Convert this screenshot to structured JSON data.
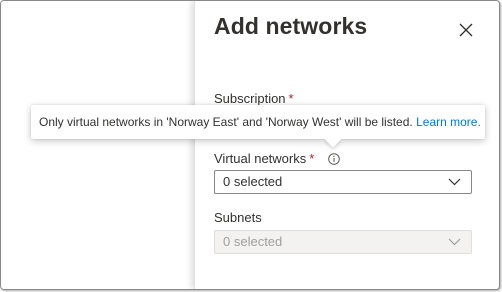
{
  "panel": {
    "title": "Add networks",
    "close_label": "Close"
  },
  "fields": {
    "subscription": {
      "label": "Subscription",
      "required_marker": "*"
    },
    "virtual_networks": {
      "label": "Virtual networks",
      "required_marker": "*",
      "value": "0 selected",
      "info_icon": "info-icon"
    },
    "subnets": {
      "label": "Subnets",
      "value": "0 selected",
      "disabled": true
    }
  },
  "tooltip": {
    "text": "Only virtual networks in 'Norway East' and 'Norway West' will be listed.",
    "link_text": "Learn more."
  },
  "colors": {
    "required": "#a4262c",
    "link": "#0078d4",
    "text": "#323130",
    "disabled_bg": "#f3f2f1"
  }
}
